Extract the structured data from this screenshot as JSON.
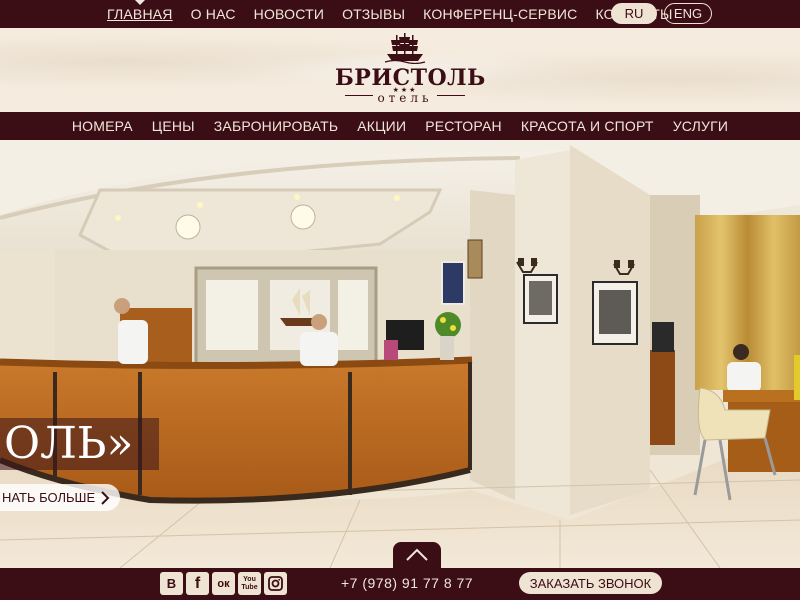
{
  "top_nav": {
    "items": [
      {
        "label": "ГЛАВНАЯ"
      },
      {
        "label": "О НАС"
      },
      {
        "label": "НОВОСТИ"
      },
      {
        "label": "ОТЗЫВЫ"
      },
      {
        "label": "КОНФЕРЕНЦ-СЕРВИС"
      },
      {
        "label": "КОНТАКТЫ"
      }
    ],
    "lang_ru": "RU",
    "lang_en": "ENG"
  },
  "logo": {
    "name": "БРИСТОЛЬ",
    "stars": "★★★",
    "subtitle": "отель"
  },
  "main_nav": {
    "items": [
      {
        "label": "НОМЕРА"
      },
      {
        "label": "ЦЕНЫ"
      },
      {
        "label": "ЗАБРОНИРОВАТЬ"
      },
      {
        "label": "АКЦИИ"
      },
      {
        "label": "РЕСТОРАН"
      },
      {
        "label": "КРАСОТА И СПОРТ"
      },
      {
        "label": "УСЛУГИ"
      }
    ]
  },
  "slider": {
    "title": "ОЛЬ»",
    "button_label": "НАТЬ БОЛЬШЕ"
  },
  "footer": {
    "social": [
      {
        "label": "B",
        "icon": "vk-icon"
      },
      {
        "label": "f",
        "icon": "facebook-icon"
      },
      {
        "label": "ок",
        "icon": "odnoklassniki-icon"
      },
      {
        "label": "You Tube",
        "icon": "youtube-icon"
      },
      {
        "label": "",
        "icon": "instagram-icon"
      }
    ],
    "phone": "+7 (978) 91 77 8 77",
    "callback_label": "ЗАКАЗАТЬ ЗВОНОК"
  },
  "colors": {
    "brand_dark": "#3b0d14",
    "cream": "#efe3d3"
  }
}
